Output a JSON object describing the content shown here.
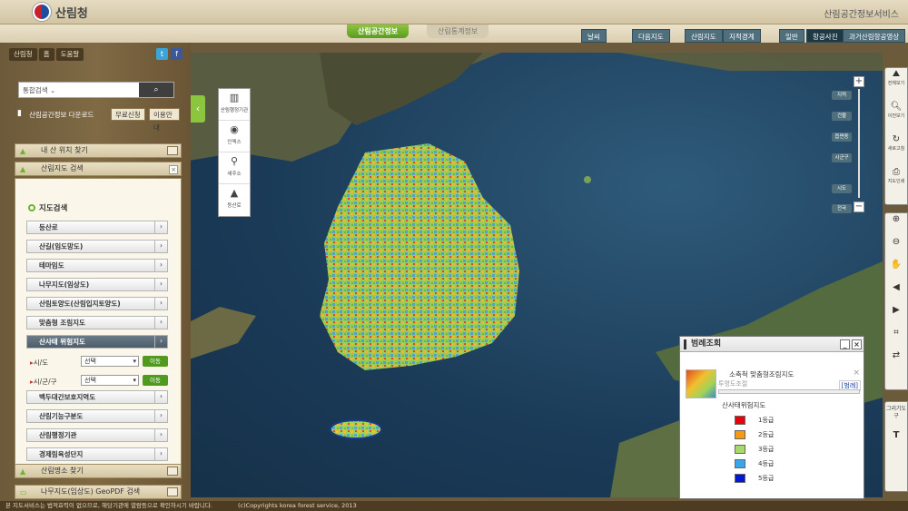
{
  "header": {
    "logo_text": "산림청",
    "service_title": "산림공간정보서비스",
    "tabs": [
      {
        "label": "산림공간정보",
        "active": true
      },
      {
        "label": "산림통계정보",
        "active": false
      }
    ],
    "buttons": {
      "weather": "날씨",
      "daum_map": "다음지도",
      "forest_map": "산림지도",
      "cadastral": "지적경계",
      "normal": "일반",
      "aerial": "항공사진",
      "past_aerial": "과거산림항공영상"
    }
  },
  "left_nav": {
    "items": [
      "산림청",
      "홈",
      "도움말"
    ],
    "twitter": "t",
    "facebook": "f"
  },
  "search": {
    "select_label": "통합검색"
  },
  "download": {
    "label": "산림공간정보 다운로드",
    "free_button": "무료신청",
    "guide_button": "이용안내"
  },
  "accordion": {
    "my_location": "내 산 위치 찾기",
    "forest_map_search": "산림지도 검색",
    "forest_place": "산림명소 찾기",
    "geopdf": "나무지도(임상도) GeoPDF 검색"
  },
  "map_search": {
    "heading": "지도검색",
    "items_top": [
      "등산로",
      "산길(임도망도)",
      "테마임도",
      "나무지도(임상도)",
      "산림토양도(산림입지토양도)",
      "맞춤형 조림지도",
      "산사태 위험지도"
    ],
    "active_index": 6,
    "filter_sido_label": "시/도",
    "filter_sigungu_label": "시/군/구",
    "select_placeholder": "선택",
    "go_label": "이동",
    "items_bottom": [
      "백두대간보호지역도",
      "산림기능구분도",
      "산림행정기관",
      "경제림육성단지"
    ]
  },
  "toolbox": {
    "items": [
      {
        "icon": "building-icon",
        "label": "산림행정기관"
      },
      {
        "icon": "search-map-icon",
        "label": "인덱스"
      },
      {
        "icon": "pin-icon",
        "label": "새주소"
      },
      {
        "icon": "mountain-icon",
        "label": "등산로"
      }
    ]
  },
  "zoom": {
    "levels": [
      "읍면동",
      "시군구",
      "시도",
      "전국",
      "건물",
      "지적"
    ]
  },
  "right_toolbar": {
    "group1": [
      {
        "icon": "korea-map-icon",
        "label": "전체보기"
      },
      {
        "icon": "magnifier-icon",
        "label": "이전보기"
      },
      {
        "icon": "refresh-icon",
        "label": "새로고침"
      },
      {
        "icon": "print-icon",
        "label": "지도인쇄"
      }
    ],
    "group2": [
      {
        "icon": "zoom-in-icon",
        "label": ""
      },
      {
        "icon": "zoom-out-icon",
        "label": ""
      },
      {
        "icon": "hand-icon",
        "label": ""
      },
      {
        "icon": "left-arrow-icon",
        "label": ""
      },
      {
        "icon": "right-arrow-icon",
        "label": ""
      },
      {
        "icon": "crop-icon",
        "label": ""
      },
      {
        "icon": "swap-icon",
        "label": ""
      }
    ],
    "group3_label": "그리기도구",
    "group3": [
      {
        "icon": "text-icon",
        "label": "T"
      }
    ]
  },
  "legend": {
    "title": "범례조회",
    "layer_name": "소축척 맞춤형조림지도",
    "transparency_label": "투명도조절",
    "legend_link": "[범례]",
    "subtitle": "산사태위험지도",
    "items": [
      {
        "label": "1등급",
        "color": "#e8000b"
      },
      {
        "label": "2등급",
        "color": "#f59a14"
      },
      {
        "label": "3등급",
        "color": "#a6d96a"
      },
      {
        "label": "4등급",
        "color": "#36a7e8"
      },
      {
        "label": "5등급",
        "color": "#0018d6"
      }
    ]
  },
  "footer": {
    "notice": "본 지도서비스는 법적효력이 없으므로, 해당기관에 열람등으로 확인하시기 바랍니다.",
    "copyright": "(c)Copyrights korea forest service, 2013"
  }
}
